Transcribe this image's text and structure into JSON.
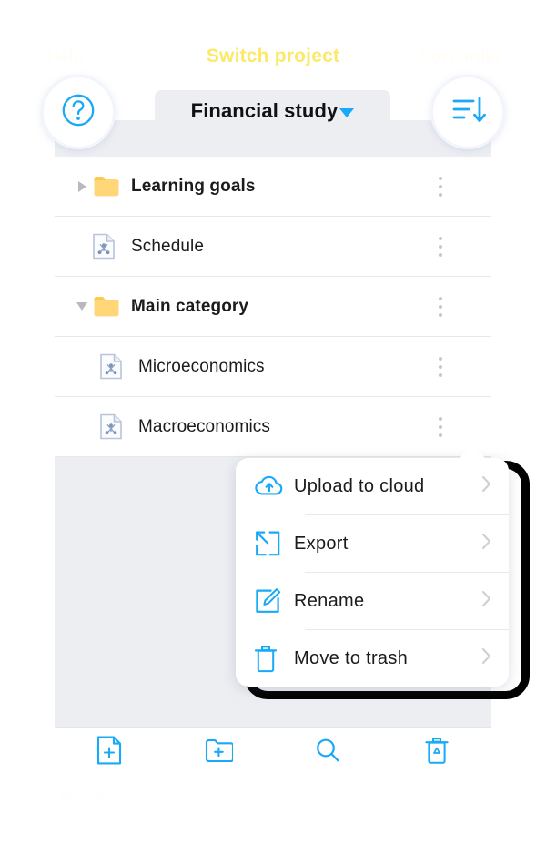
{
  "annotations": {
    "switch_project": "Switch project",
    "help_caption": "Help",
    "sort_caption": "Sort order",
    "bottom_captions": [
      "New document",
      "New folder",
      "Search",
      "Recycle bin"
    ],
    "highlight_color": "#000000",
    "caption_color": "#fbe96a"
  },
  "header": {
    "help_icon": "question-mark-circle-icon",
    "sort_icon": "sort-descending-icon",
    "project_name": "Financial study",
    "project_caret_icon": "caret-down-icon",
    "accent_color": "#18a9f7"
  },
  "file_list": {
    "rows": [
      {
        "label": "Learning goals",
        "type": "folder",
        "indent": 0,
        "expanded": false,
        "bold": true,
        "icon": "folder-icon",
        "disclosure": "triangle-right-icon",
        "more_icon": "more-vertical-icon"
      },
      {
        "label": "Schedule",
        "type": "document",
        "indent": 0,
        "bold": false,
        "icon": "mindmap-document-icon",
        "disclosure": "none",
        "more_icon": "more-vertical-icon"
      },
      {
        "label": "Main category",
        "type": "folder",
        "indent": 0,
        "expanded": true,
        "bold": true,
        "icon": "folder-icon",
        "disclosure": "triangle-down-icon",
        "more_icon": "more-vertical-icon"
      },
      {
        "label": "Microeconomics",
        "type": "document",
        "indent": 1,
        "bold": false,
        "icon": "mindmap-document-icon",
        "disclosure": "none",
        "more_icon": "more-vertical-icon"
      },
      {
        "label": "Macroeconomics",
        "type": "document",
        "indent": 1,
        "bold": false,
        "icon": "mindmap-document-icon",
        "disclosure": "none",
        "more_icon": "more-vertical-icon"
      }
    ]
  },
  "context_menu": {
    "items": [
      {
        "label": "Upload to cloud",
        "icon": "cloud-upload-icon",
        "chevron": "chevron-right-icon"
      },
      {
        "label": "Export",
        "icon": "export-arrow-icon",
        "chevron": "chevron-right-icon"
      },
      {
        "label": "Rename",
        "icon": "edit-pencil-icon",
        "chevron": "chevron-right-icon"
      },
      {
        "label": "Move to trash",
        "icon": "trash-icon",
        "chevron": "chevron-right-icon"
      }
    ]
  },
  "bottom_toolbar": {
    "buttons": [
      {
        "name": "new-document",
        "icon": "document-plus-icon"
      },
      {
        "name": "new-folder",
        "icon": "folder-plus-icon"
      },
      {
        "name": "search",
        "icon": "search-icon"
      },
      {
        "name": "recycle-bin",
        "icon": "trash-recycle-icon"
      }
    ]
  }
}
